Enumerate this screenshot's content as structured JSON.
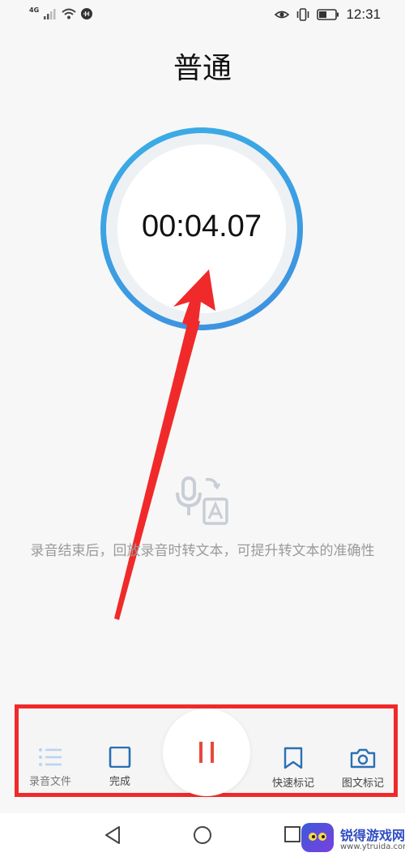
{
  "status_bar": {
    "network": "4G",
    "time": "12:31"
  },
  "page": {
    "title": "普通"
  },
  "recorder": {
    "timer": "00:04.07"
  },
  "hint": {
    "text": "录音结束后，回放录音时转文本，可提升转文本的准确性"
  },
  "toolbar": {
    "files_label": "录音文件",
    "done_label": "完成",
    "quick_mark_label": "快速标记",
    "photo_mark_label": "图文标记"
  },
  "watermark": {
    "title": "锐得游戏网",
    "url": "www.ytruida.com"
  },
  "colors": {
    "accent": "#3aaee6",
    "pause_red": "#e8483c",
    "toolbar_blue": "#2a6fb5",
    "annotation_red": "#f02a2a"
  }
}
